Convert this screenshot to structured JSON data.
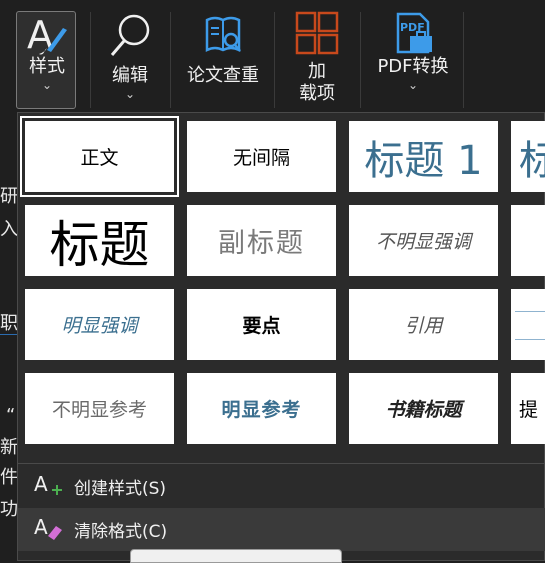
{
  "ribbon": {
    "styles_label": "样式",
    "edit_label": "编辑",
    "check_label": "论文查重",
    "addon_label_1": "加",
    "addon_label_2": "载项",
    "pdf_label": "PDF转换",
    "pdf_icon_text": "PDF",
    "chevron": "⌄"
  },
  "doc_fragments": [
    "研",
    "入",
    "职",
    "“",
    "新",
    "件",
    "功"
  ],
  "gallery": {
    "tiles": [
      "正文",
      "无间隔",
      "标题 1",
      "标",
      "标题",
      "副标题",
      "不明显强调",
      "明显强调",
      "要点",
      "引用",
      "不明显参考",
      "明显参考",
      "书籍标题",
      "提"
    ]
  },
  "menu": {
    "create_style": "创建样式(S)",
    "clear_format": "清除格式(C)"
  },
  "colors": {
    "accent_blue": "#2b6cb0",
    "heading_blue": "#3b6f8f",
    "addon_orange": "#c8491c",
    "pen_blue": "#3d9be9"
  }
}
